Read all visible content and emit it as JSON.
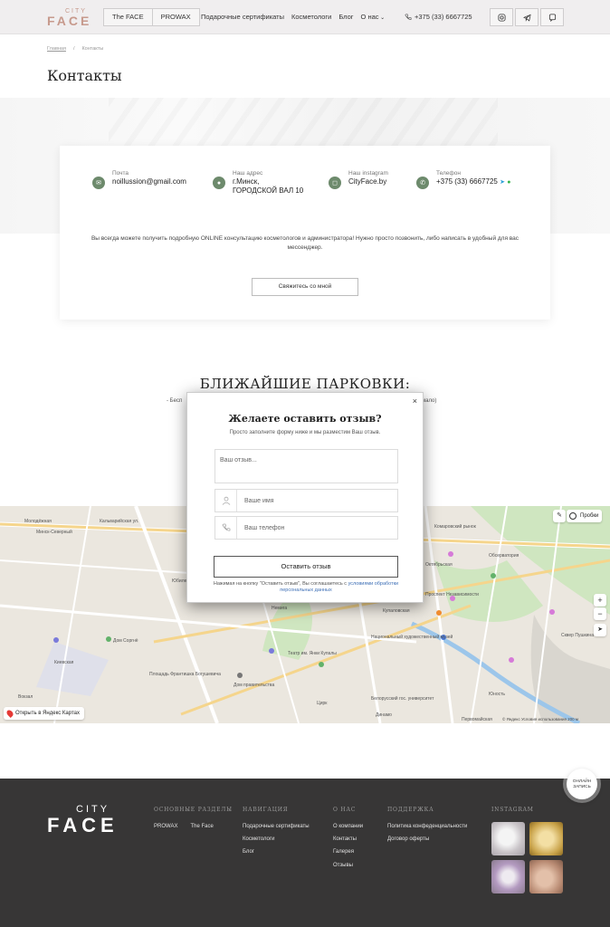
{
  "header": {
    "logo_city": "CITY",
    "logo_face": "FACE",
    "brand_tabs": [
      "The FACE",
      "PROWAX"
    ],
    "nav": [
      "Подарочные сертификаты",
      "Косметологи",
      "Блог",
      "О нас"
    ],
    "phone": "+375 (33) 6667725",
    "social_icons": [
      "instagram-icon",
      "telegram-icon",
      "viber-icon"
    ]
  },
  "breadcrumb": {
    "home": "Главная",
    "separator": "/",
    "current": "Контакты"
  },
  "page_title": "Контакты",
  "contacts": {
    "email": {
      "label": "Почта",
      "value": "noillussion@gmail.com"
    },
    "address": {
      "label": "Наш адрес",
      "line1": "г.Минск,",
      "line2": "ГОРОДСКОЙ ВАЛ 10"
    },
    "instagram": {
      "label": "Наш instagram",
      "value": "CityFace.by"
    },
    "phone": {
      "label": "Телефон",
      "value": "+375 (33) 6667725"
    },
    "info": "Вы всегда можете получить подробную ONLINE консультацию косметологов и администратора! Нужно просто позвонить, либо написать в удобный для вас мессенджер.",
    "button": "Свяжитесь со мной"
  },
  "parking": {
    "title": "БЛИЖАЙШИЕ ПАРКОВКИ:",
    "line_start": "- Бесп",
    "line_end": "мало)"
  },
  "modal": {
    "close": "×",
    "title": "Желаете оставить отзыв?",
    "subtitle": "Просто заполните форму ниже и мы разместим Ваш отзыв.",
    "review_placeholder": "Ваш отзыв...",
    "name_placeholder": "Ваше имя",
    "phone_placeholder": "Ваш телефон",
    "submit": "Оставить отзыв",
    "note_prefix": "Нажимая на кнопку \"Оставить отзыв\", Вы соглашаетесь с ",
    "note_link": "условиями обработки персональных данных"
  },
  "map": {
    "labels": [
      "Молодёжная",
      "Минск-Северный",
      "Кальварийская ул.",
      "Юбилейная",
      "Дом Соргнё",
      "Площадь Франтишка Богушевича",
      "Дом правительства",
      "Купаловская",
      "Театр им. Янки Купалы",
      "Национальный художественный музей",
      "Белорусский гос. университет",
      "Проспект Независимости",
      "Первомайская",
      "Вокзал",
      "Юность",
      "Киевская",
      "Обсерватория",
      "Комаровский рынок",
      "Немига",
      "Динамо",
      "Октябрьская",
      "Цирк",
      "Сквер Пушкина"
    ],
    "open_in_yandex": "Открыть в Яндекс Картах",
    "traffic": "Пробки",
    "zoom_in": "+",
    "zoom_out": "−",
    "copyright": "© Яндекс  Условия использования",
    "scale": "200 м"
  },
  "online_chip": {
    "line1": "ОНЛАЙН",
    "line2": "ЗАПИСЬ"
  },
  "footer": {
    "logo_city": "CITY",
    "logo_face": "FACE",
    "sections": {
      "title": "ОСНОВНЫЕ РАЗДЕЛЫ",
      "links": [
        "PROWAX",
        "The Face"
      ]
    },
    "navigation": {
      "title": "НАВИГАЦИЯ",
      "links": [
        "Подарочные сертификаты",
        "Косметологи",
        "Блог"
      ]
    },
    "about": {
      "title": "О НАС",
      "links": [
        "О компании",
        "Контакты",
        "Галерея",
        "Отзывы"
      ]
    },
    "support": {
      "title": "ПОДДЕРЖКА",
      "links": [
        "Политика конфеденциальности",
        "Договор оферты"
      ]
    },
    "instagram": {
      "title": "INSTAGRAM"
    }
  },
  "colors": {
    "accent": "#c79a8d",
    "icon_green": "#6d8a6c",
    "footer_bg": "#373636",
    "link": "#3d6fb6"
  }
}
